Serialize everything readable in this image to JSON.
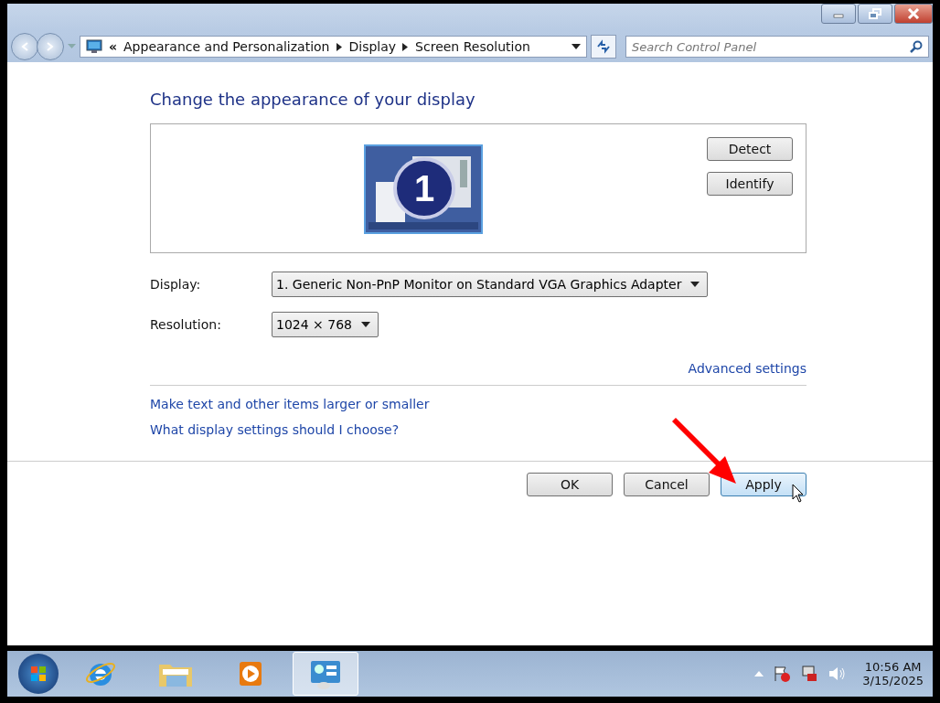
{
  "address_bar": {
    "overflow": "«",
    "breadcrumbs": [
      "Appearance and Personalization",
      "Display",
      "Screen Resolution"
    ]
  },
  "search": {
    "placeholder": "Search Control Panel"
  },
  "heading": "Change the appearance of your display",
  "preview": {
    "monitor_number": "1",
    "buttons": [
      "Detect",
      "Identify"
    ]
  },
  "fields": [
    {
      "label": "Display:",
      "value": "1. Generic Non-PnP Monitor on Standard VGA Graphics Adapter"
    },
    {
      "label": "Resolution:",
      "value": "1024 × 768"
    }
  ],
  "advanced_link": "Advanced settings",
  "links": [
    "Make text and other items larger or smaller",
    "What display settings should I choose?"
  ],
  "dialog_buttons": [
    {
      "label": "OK",
      "hovered": false
    },
    {
      "label": "Cancel",
      "hovered": false
    },
    {
      "label": "Apply",
      "hovered": true
    }
  ],
  "taskbar": {
    "items": [
      {
        "kind": "browser",
        "active": false
      },
      {
        "kind": "folder",
        "active": false
      },
      {
        "kind": "media",
        "active": false
      },
      {
        "kind": "control-panel",
        "active": true
      }
    ],
    "time": "10:56 AM",
    "date": "3/15/2025"
  }
}
